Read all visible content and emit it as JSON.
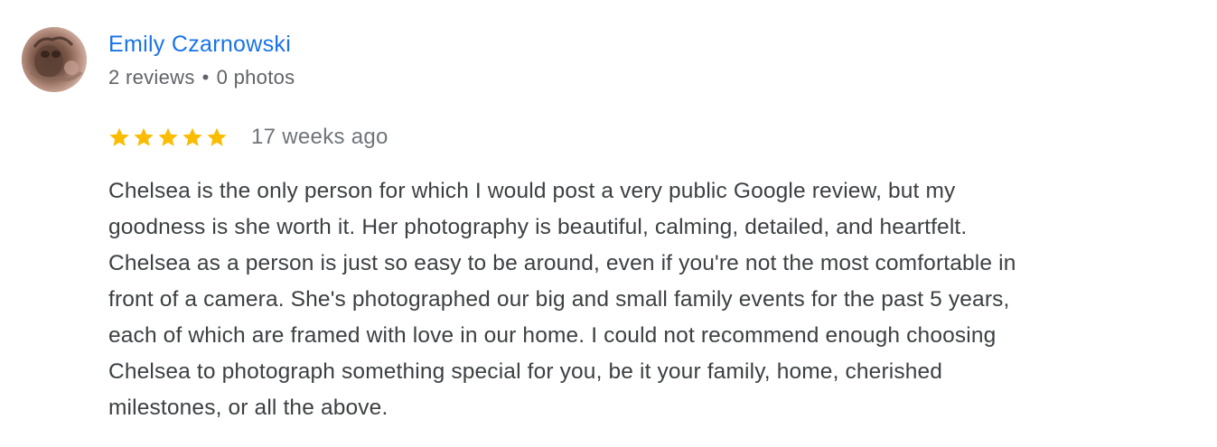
{
  "reviewer": {
    "name": "Emily Czarnowski",
    "reviews_count": "2 reviews",
    "separator": "•",
    "photos_count": "0 photos"
  },
  "review": {
    "rating": 5,
    "max_rating": 5,
    "star_color": "#fbbc04",
    "time": "17 weeks ago",
    "text_lines": [
      "Chelsea is the only person for which I would post a very public Google review, but my",
      "goodness is she worth it. Her photography is beautiful, calming, detailed, and heartfelt.",
      "Chelsea as a person is just so easy to be around, even if you're not the most comfortable in",
      "front of a camera. She's photographed our big and small family events for the past 5 years,",
      "each of which are framed with love in our home. I could not recommend enough choosing",
      "Chelsea to photograph something special for you, be it your family, home, cherished",
      "milestones, or all the above."
    ]
  },
  "colors": {
    "name_link": "#1a73e8",
    "meta_text": "#5f6368",
    "body_text": "#3c4043"
  }
}
